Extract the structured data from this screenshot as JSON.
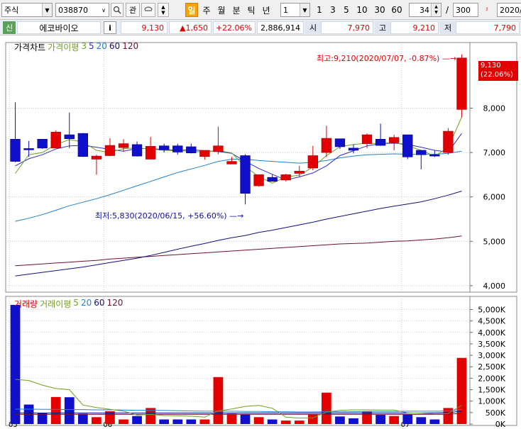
{
  "toolbar": {
    "type_label": "주식",
    "code_value": "038870",
    "gwan_label": "관",
    "il_label": "일",
    "ju_label": "주",
    "wol_label": "월",
    "bun_label": "분",
    "tik_label": "틱",
    "nyeon_label": "년",
    "unit_value": "1",
    "periods": [
      "1",
      "3",
      "5",
      "10",
      "30",
      "60"
    ],
    "count_value": "34",
    "slash": "/",
    "total_value": "300",
    "date_value": "2020/0"
  },
  "info": {
    "market_badge": "신",
    "stock_name": "에코바이오",
    "i_label": "i",
    "price": "9,130",
    "change": "▲1,650",
    "change_pct": "+22.06%",
    "volume": "2,886,914",
    "open_label": "시",
    "open_value": "7,970",
    "high_label": "고",
    "high_value": "9,210",
    "low_label": "저",
    "low_value": "7,790"
  },
  "price_legend": {
    "chart_label": "가격차트",
    "ma_label": "가격이평",
    "periods": [
      "3",
      "5",
      "20",
      "60",
      "120"
    ]
  },
  "volume_legend": {
    "chart_label": "거래량",
    "ma_label": "거래이평",
    "periods": [
      "5",
      "20",
      "60",
      "120"
    ]
  },
  "annotations": {
    "high": "최고:9,210(2020/07/07, -0.87%)",
    "low": "최저:5,830(2020/06/15, +56.60%)",
    "price_tag": "9,130",
    "price_tag_pct": "(22.06%)"
  },
  "x_labels": [
    "05",
    "06",
    "07"
  ],
  "colors": {
    "up": "#e30000",
    "down": "#1010cc",
    "ma3": "#70a020",
    "ma5": "#3030c0",
    "ma20": "#2080d0",
    "ma60": "#101080",
    "ma120": "#701030"
  },
  "chart_data": [
    {
      "type": "candlestick",
      "title": "가격차트",
      "y_ticks": [
        4000,
        5000,
        6000,
        7000,
        8000
      ],
      "y_tick_labels": [
        "4,000",
        "5,000",
        "6,000",
        "7,000",
        "8,000"
      ],
      "ylim": [
        3950,
        9350
      ],
      "candles": [
        {
          "o": 7300,
          "h": 8130,
          "l": 6780,
          "c": 6800
        },
        {
          "o": 7090,
          "h": 7260,
          "l": 6900,
          "c": 7060
        },
        {
          "o": 7300,
          "h": 7300,
          "l": 7080,
          "c": 7100
        },
        {
          "o": 7100,
          "h": 7500,
          "l": 7100,
          "c": 7460
        },
        {
          "o": 7400,
          "h": 7900,
          "l": 7100,
          "c": 7310
        },
        {
          "o": 7430,
          "h": 7440,
          "l": 6900,
          "c": 6910
        },
        {
          "o": 6850,
          "h": 6950,
          "l": 6500,
          "c": 6920
        },
        {
          "o": 6930,
          "h": 7320,
          "l": 6920,
          "c": 7160
        },
        {
          "o": 7110,
          "h": 7300,
          "l": 7020,
          "c": 7200
        },
        {
          "o": 7180,
          "h": 7250,
          "l": 6910,
          "c": 6920
        },
        {
          "o": 6850,
          "h": 7350,
          "l": 6850,
          "c": 7140
        },
        {
          "o": 7150,
          "h": 7200,
          "l": 7000,
          "c": 7060
        },
        {
          "o": 7150,
          "h": 7200,
          "l": 6950,
          "c": 7010
        },
        {
          "o": 7130,
          "h": 7200,
          "l": 6980,
          "c": 6990
        },
        {
          "o": 6910,
          "h": 7010,
          "l": 6840,
          "c": 7050
        },
        {
          "o": 7020,
          "h": 7580,
          "l": 6960,
          "c": 7150
        },
        {
          "o": 6740,
          "h": 6900,
          "l": 6740,
          "c": 6800
        },
        {
          "o": 6930,
          "h": 6960,
          "l": 5830,
          "c": 6080
        },
        {
          "o": 6250,
          "h": 6500,
          "l": 6230,
          "c": 6500
        },
        {
          "o": 6440,
          "h": 6500,
          "l": 6350,
          "c": 6350
        },
        {
          "o": 6380,
          "h": 6520,
          "l": 6350,
          "c": 6500
        },
        {
          "o": 6530,
          "h": 6700,
          "l": 6450,
          "c": 6580
        },
        {
          "o": 6650,
          "h": 7150,
          "l": 6600,
          "c": 6930
        },
        {
          "o": 7000,
          "h": 7600,
          "l": 6900,
          "c": 7320
        },
        {
          "o": 7310,
          "h": 7310,
          "l": 7080,
          "c": 7130
        },
        {
          "o": 7100,
          "h": 7180,
          "l": 6980,
          "c": 7050
        },
        {
          "o": 7200,
          "h": 7430,
          "l": 7100,
          "c": 7400
        },
        {
          "o": 7300,
          "h": 7650,
          "l": 7150,
          "c": 7160
        },
        {
          "o": 7220,
          "h": 7400,
          "l": 7050,
          "c": 7340
        },
        {
          "o": 7400,
          "h": 7400,
          "l": 6850,
          "c": 6900
        },
        {
          "o": 7050,
          "h": 7050,
          "l": 6620,
          "c": 6950
        },
        {
          "o": 6950,
          "h": 7050,
          "l": 6900,
          "c": 6920
        },
        {
          "o": 7000,
          "h": 7550,
          "l": 6950,
          "c": 7480
        },
        {
          "o": 7970,
          "h": 9210,
          "l": 7790,
          "c": 9130
        }
      ],
      "ma": {
        "3": [
          6530,
          6950,
          7000,
          7180,
          7290,
          7240,
          7050,
          7000,
          7090,
          7100,
          7080,
          7050,
          7040,
          7030,
          7010,
          7050,
          6990,
          6680,
          6460,
          6310,
          6450,
          6490,
          6670,
          6930,
          7130,
          7180,
          7210,
          7200,
          7230,
          7150,
          7050,
          6920,
          7110,
          7800
        ],
        "5": [
          6700,
          6860,
          6950,
          7080,
          7150,
          7160,
          7120,
          7070,
          7030,
          7090,
          7090,
          7070,
          7050,
          7060,
          7040,
          7020,
          6980,
          6800,
          6640,
          6510,
          6380,
          6450,
          6540,
          6700,
          6930,
          7040,
          7150,
          7200,
          7210,
          7180,
          7120,
          7050,
          7010,
          7430
        ],
        "20": [
          5450,
          5520,
          5600,
          5700,
          5800,
          5880,
          5960,
          6050,
          6150,
          6250,
          6350,
          6450,
          6550,
          6630,
          6710,
          6800,
          6850,
          6850,
          6820,
          6800,
          6780,
          6760,
          6780,
          6820,
          6880,
          6920,
          6950,
          6960,
          6970,
          6960,
          6960,
          6960,
          6980,
          7030
        ],
        "60": [
          4220,
          4260,
          4300,
          4340,
          4380,
          4420,
          4470,
          4520,
          4570,
          4620,
          4680,
          4750,
          4820,
          4890,
          4950,
          5020,
          5080,
          5130,
          5200,
          5250,
          5310,
          5370,
          5430,
          5500,
          5560,
          5620,
          5680,
          5740,
          5790,
          5840,
          5890,
          5960,
          6040,
          6130
        ],
        "120": [
          4450,
          4470,
          4490,
          4510,
          4530,
          4550,
          4570,
          4600,
          4620,
          4640,
          4660,
          4680,
          4700,
          4720,
          4740,
          4760,
          4780,
          4800,
          4820,
          4840,
          4860,
          4880,
          4900,
          4920,
          4940,
          4950,
          4960,
          4980,
          5000,
          5010,
          5030,
          5050,
          5080,
          5120
        ]
      }
    },
    {
      "type": "bar",
      "title": "거래량",
      "y_ticks": [
        0,
        500000,
        1000000,
        1500000,
        2000000,
        2500000,
        3000000,
        3500000,
        4000000,
        4500000,
        5000000
      ],
      "y_tick_labels": [
        "0K",
        "500K",
        "1,000K",
        "1,500K",
        "2,000K",
        "2,500K",
        "3,000K",
        "3,500K",
        "4,000K",
        "4,500K",
        "5,000K"
      ],
      "ylim": [
        0,
        5200000
      ],
      "volumes": [
        5200000,
        850000,
        480000,
        1180000,
        1170000,
        450000,
        300000,
        560000,
        200000,
        350000,
        700000,
        200000,
        200000,
        200000,
        200000,
        2050000,
        450000,
        420000,
        300000,
        200000,
        150000,
        150000,
        420000,
        1370000,
        330000,
        250000,
        560000,
        400000,
        350000,
        420000,
        300000,
        200000,
        700000,
        2886914
      ],
      "ma": {
        "5": [
          1950,
          1900,
          1700,
          1550,
          1500,
          830,
          720,
          640,
          560,
          390,
          420,
          370,
          360,
          340,
          300,
          570,
          660,
          770,
          810,
          690,
          300,
          260,
          270,
          520,
          600,
          620,
          620,
          610,
          610,
          490,
          470,
          440,
          460,
          820
        ],
        "20": [
          650,
          650,
          640,
          640,
          630,
          630,
          620,
          620,
          610,
          600,
          600,
          590,
          580,
          570,
          560,
          560,
          560,
          550,
          550,
          540,
          540,
          530,
          530,
          540,
          540,
          540,
          550,
          550,
          550,
          560,
          560,
          560,
          570,
          640
        ],
        "60": [
          480,
          480,
          480,
          480,
          480,
          480,
          480,
          480,
          480,
          480,
          480,
          480,
          480,
          480,
          480,
          480,
          480,
          480,
          480,
          480,
          480,
          480,
          480,
          480,
          480,
          480,
          480,
          480,
          480,
          480,
          480,
          490,
          500,
          560
        ],
        "120": [
          420,
          420,
          420,
          420,
          420,
          420,
          420,
          420,
          420,
          420,
          420,
          420,
          420,
          420,
          420,
          420,
          420,
          420,
          420,
          420,
          420,
          420,
          420,
          420,
          420,
          420,
          420,
          420,
          420,
          420,
          420,
          420,
          430,
          460
        ]
      }
    }
  ]
}
